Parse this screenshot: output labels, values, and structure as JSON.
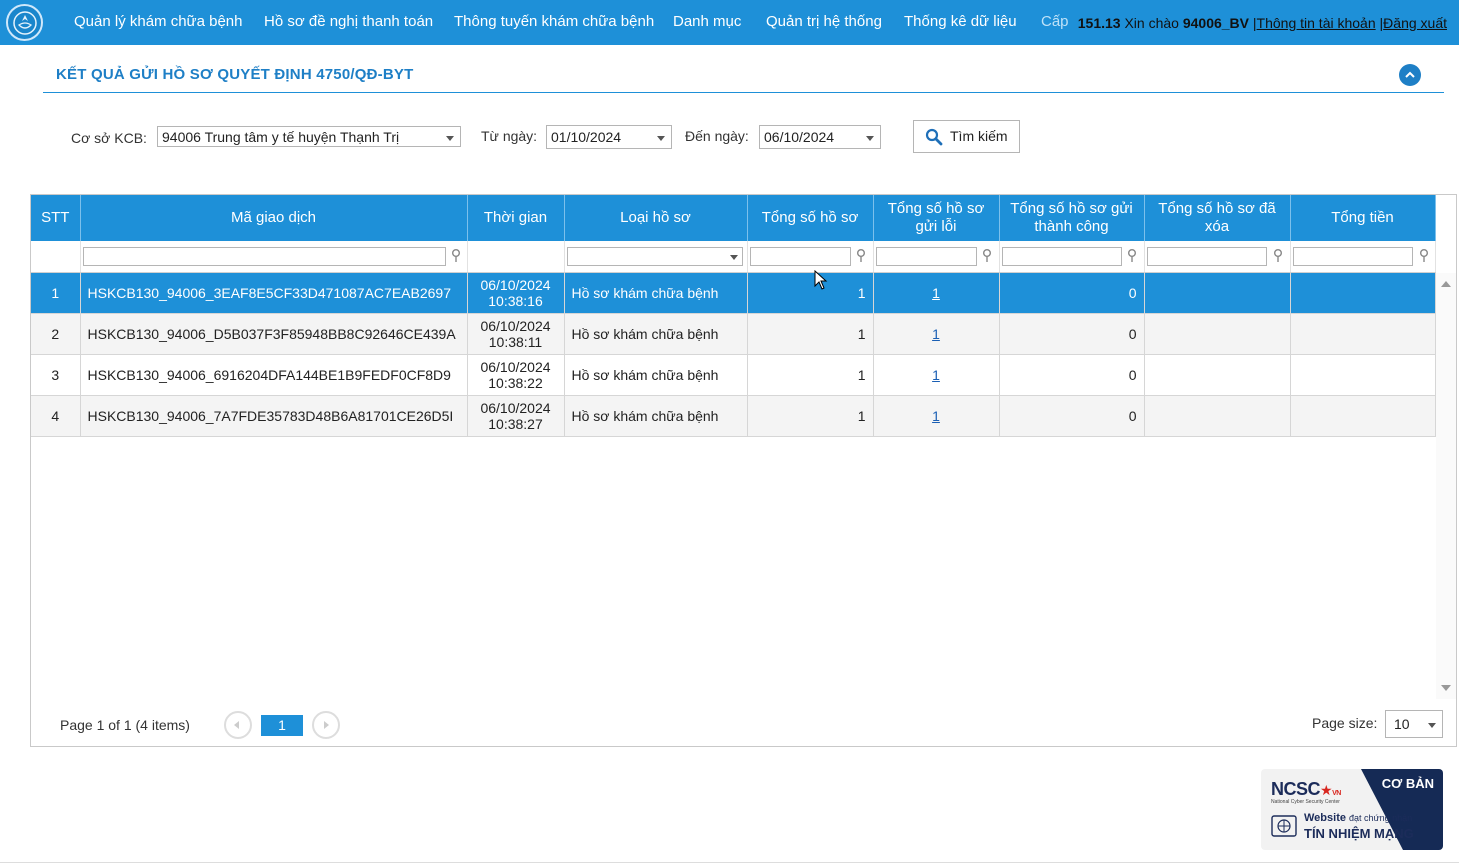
{
  "nav": {
    "items": [
      "Quản lý khám chữa bệnh",
      "Hồ sơ đề nghị thanh toán",
      "Thông tuyến khám chữa bệnh",
      "Danh mục",
      "Quản trị hệ thống",
      "Thống kê dữ liệu",
      "Cấp"
    ],
    "overlap_text": "151.13",
    "greeting": "Xin chào",
    "username": "94006_BV",
    "separator1": "|",
    "account_info": "Thông tin tài khoản",
    "separator2": "|",
    "logout": "Đăng xuất"
  },
  "section": {
    "title": "KẾT QUẢ GỬI HỒ SƠ QUYẾT ĐỊNH 4750/QĐ-BYT",
    "collapse_icon": "chevron-up-icon"
  },
  "filters": {
    "facility_label": "Cơ sở KCB:",
    "facility_value": "94006 Trung tâm y tế huyện Thạnh Trị",
    "from_label": "Từ ngày:",
    "from_value": "01/10/2024",
    "to_label": "Đến ngày:",
    "to_value": "06/10/2024",
    "search_button": "Tìm kiếm"
  },
  "grid": {
    "columns": [
      "STT",
      "Mã giao dịch",
      "Thời gian",
      "Loại hồ sơ",
      "Tổng số hồ sơ",
      "Tổng số hồ sơ gửi lỗi",
      "Tổng số hồ sơ gửi thành công",
      "Tổng số hồ sơ đã xóa",
      "Tổng tiền"
    ],
    "rows": [
      {
        "stt": "1",
        "ma": "HSKCB130_94006_3EAF8E5CF33D471087AC7EAB2697",
        "date": "06/10/2024",
        "time": "10:38:16",
        "loai": "Hồ sơ khám chữa bệnh",
        "tong": "1",
        "loi": "1",
        "thanhcong": "0",
        "daxoa": "",
        "tien": ""
      },
      {
        "stt": "2",
        "ma": "HSKCB130_94006_D5B037F3F85948BB8C92646CE439A",
        "date": "06/10/2024",
        "time": "10:38:11",
        "loai": "Hồ sơ khám chữa bệnh",
        "tong": "1",
        "loi": "1",
        "thanhcong": "0",
        "daxoa": "",
        "tien": ""
      },
      {
        "stt": "3",
        "ma": "HSKCB130_94006_6916204DFA144BE1B9FEDF0CF8D9",
        "date": "06/10/2024",
        "time": "10:38:22",
        "loai": "Hồ sơ khám chữa bệnh",
        "tong": "1",
        "loi": "1",
        "thanhcong": "0",
        "daxoa": "",
        "tien": ""
      },
      {
        "stt": "4",
        "ma": "HSKCB130_94006_7A7FDE35783D48B6A81701CE26D5I",
        "date": "06/10/2024",
        "time": "10:38:27",
        "loai": "Hồ sơ khám chữa bệnh",
        "tong": "1",
        "loi": "1",
        "thanhcong": "0",
        "daxoa": "",
        "tien": ""
      }
    ],
    "selected_row": 1
  },
  "pager": {
    "info": "Page 1 of 1 (4 items)",
    "current_page": "1",
    "page_size_label": "Page size:",
    "page_size_value": "10"
  },
  "badge": {
    "org": "NCSC",
    "org_sub": "VN",
    "org_full": "National Cyber Security Center",
    "level": "CƠ BẢN",
    "line1_bold": "Website",
    "line1_rest": "đạt chứng nhận",
    "line2": "TÍN NHIỆM MẠNG"
  },
  "colors": {
    "primary": "#1e90d8",
    "title": "#1e7fc6",
    "selected_row": "#1e90d8",
    "alt_row": "#f4f4f4"
  }
}
